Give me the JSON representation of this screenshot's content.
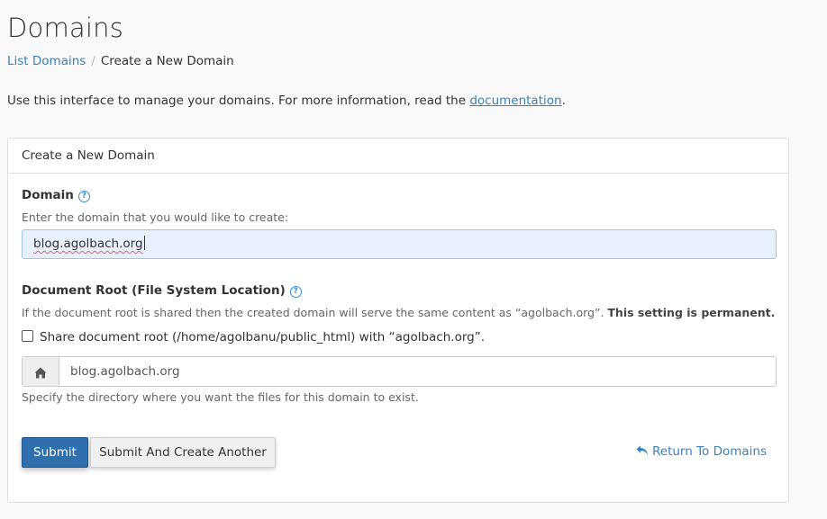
{
  "page": {
    "title": "Domains"
  },
  "breadcrumb": {
    "parent": "List Domains",
    "separator": "/",
    "current": "Create a New Domain"
  },
  "intro": {
    "text": "Use this interface to manage your domains. For more information, read the",
    "link": "documentation",
    "suffix": "."
  },
  "panel": {
    "title": "Create a New Domain",
    "domain": {
      "label": "Domain",
      "help_icon": "?",
      "help": "Enter the domain that you would like to create:",
      "value": "blog.agolbach.org"
    },
    "docroot": {
      "label": "Document Root (File System Location)",
      "help_icon": "?",
      "help": "If the document root is shared then the created domain will serve the same content as “agolbach.org”.",
      "help_strong": "This setting is permanent.",
      "share_label": "Share document root (/home/agolbanu/public_html) with “agolbach.org”.",
      "share_checked": false,
      "value": "blog.agolbach.org",
      "icon": "home-icon",
      "hint": "Specify the directory where you want the files for this domain to exist."
    },
    "buttons": {
      "submit": "Submit",
      "submit_another": "Submit And Create Another",
      "return": "Return To Domains",
      "return_icon": "reply-arrow-icon"
    }
  },
  "colors": {
    "link": "#3a7fbf",
    "primary_button": "#2f6fad",
    "input_focus_bg": "#e8f0fe",
    "help_icon": "#3a8fd4"
  }
}
